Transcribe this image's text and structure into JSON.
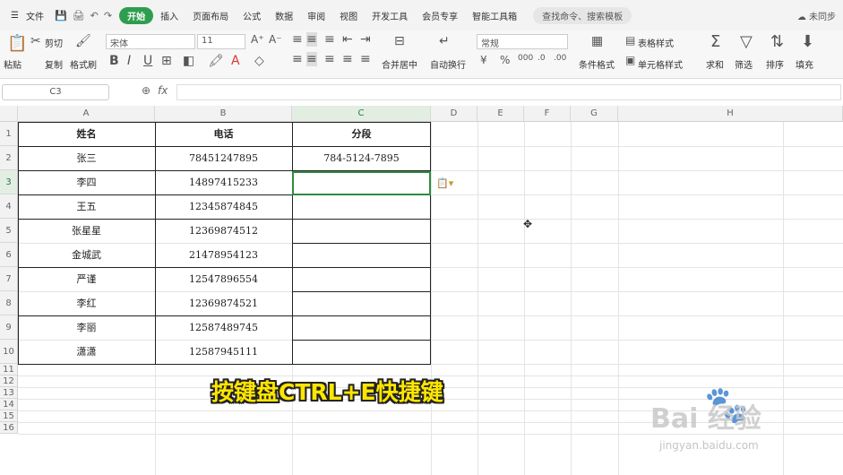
{
  "menubar": {
    "file_label": "文件",
    "tabs": [
      "开始",
      "插入",
      "页面布局",
      "公式",
      "数据",
      "审阅",
      "视图",
      "开发工具",
      "会员专享",
      "智能工具箱"
    ],
    "active_tab": "开始",
    "search_placeholder": "查找命令、搜索模板",
    "sync_label": "未同步"
  },
  "ribbon": {
    "paste": "粘贴",
    "cut": "剪切",
    "copy": "复制",
    "format_painter": "格式刷",
    "font_name": "宋体",
    "font_size": "11",
    "number_format": "常规",
    "merge_center": "合并居中",
    "wrap_text": "自动换行",
    "conditional_format": "条件格式",
    "table_style": "表格样式",
    "cell_style": "单元格样式",
    "sum": "求和",
    "filter": "筛选",
    "sort": "排序",
    "fill": "填充"
  },
  "formula_bar": {
    "name_box": "C3",
    "fx": "fx",
    "value": ""
  },
  "sheet": {
    "columns": [
      "A",
      "B",
      "C",
      "D",
      "E",
      "F",
      "G",
      "H"
    ],
    "rows": [
      "1",
      "2",
      "3",
      "4",
      "5",
      "6",
      "7",
      "8",
      "9",
      "10",
      "11",
      "12",
      "13",
      "14",
      "15",
      "16"
    ],
    "header": {
      "name": "姓名",
      "phone": "电话",
      "segment": "分段"
    },
    "data": [
      {
        "name": "张三",
        "phone": "78451247895",
        "segment": "784-5124-7895"
      },
      {
        "name": "李四",
        "phone": "14897415233",
        "segment": ""
      },
      {
        "name": "王五",
        "phone": "12345874845",
        "segment": ""
      },
      {
        "name": "张星星",
        "phone": "12369874512",
        "segment": ""
      },
      {
        "name": "金城武",
        "phone": "21478954123",
        "segment": ""
      },
      {
        "name": "严谨",
        "phone": "12547896554",
        "segment": ""
      },
      {
        "name": "李红",
        "phone": "12369874521",
        "segment": ""
      },
      {
        "name": "李丽",
        "phone": "12587489745",
        "segment": ""
      },
      {
        "name": "潇潇",
        "phone": "12587945111",
        "segment": ""
      }
    ]
  },
  "caption": "按键盘CTRL+E快捷键",
  "watermark": {
    "brand": "Bai 经验",
    "url": "jingyan.baidu.com"
  }
}
